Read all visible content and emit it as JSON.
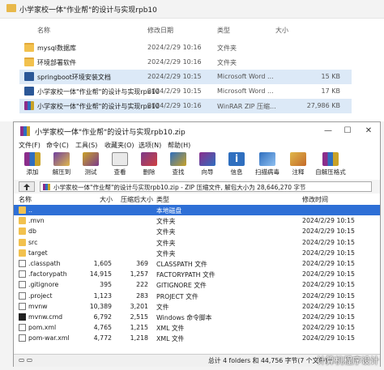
{
  "explorer": {
    "title": "小学家校一体\"作业帮\"的设计与实现rpb10",
    "columns": {
      "name": "名称",
      "date": "修改日期",
      "type": "类型",
      "size": "大小"
    },
    "rows": [
      {
        "name": "mysql数据库",
        "date": "2024/2/29 10:16",
        "type": "文件夹",
        "size": "",
        "icon": "folder-icon"
      },
      {
        "name": "环境部署软件",
        "date": "2024/2/29 10:16",
        "type": "文件夹",
        "size": "",
        "icon": "folder-icon"
      },
      {
        "name": "springboot环境安装文档",
        "date": "2024/2/29 10:15",
        "type": "Microsoft Word ...",
        "size": "15 KB",
        "icon": "word-doc-icon"
      },
      {
        "name": "小学家校一体\"作业帮\"的设计与实现rpb10",
        "date": "2024/2/29 10:15",
        "type": "Microsoft Word ...",
        "size": "17 KB",
        "icon": "word-doc-icon"
      },
      {
        "name": "小学家校一体\"作业帮\"的设计与实现rpb10",
        "date": "2024/2/29 10:16",
        "type": "WinRAR ZIP 压缩...",
        "size": "27,986 KB",
        "icon": "zip-archive-icon"
      }
    ]
  },
  "winrar": {
    "title": "小学家校一体\"作业帮\"的设计与实现rpb10.zip",
    "menu": [
      "文件(F)",
      "命令(C)",
      "工具(S)",
      "收藏夹(O)",
      "选项(N)",
      "帮助(H)"
    ],
    "toolbar": [
      "添加",
      "解压到",
      "测试",
      "查看",
      "删除",
      "查找",
      "向导",
      "信息",
      "扫描病毒",
      "注释",
      "自解压格式"
    ],
    "address": "小学家校一体\"作业帮\"的设计与实现rpb10.zip - ZIP 压缩文件, 解包大小为 28,646,270 字节",
    "columns": {
      "name": "名称",
      "size": "大小",
      "packed": "压缩后大小",
      "type": "类型",
      "modified": "修改时间"
    },
    "files": [
      {
        "name": "..",
        "size": "",
        "packed": "",
        "type": "本地磁盘",
        "modified": "",
        "icon": "folder-icon"
      },
      {
        "name": ".mvn",
        "size": "",
        "packed": "",
        "type": "文件夹",
        "modified": "2024/2/29 10:15",
        "icon": "folder-icon"
      },
      {
        "name": "db",
        "size": "",
        "packed": "",
        "type": "文件夹",
        "modified": "2024/2/29 10:15",
        "icon": "folder-icon"
      },
      {
        "name": "src",
        "size": "",
        "packed": "",
        "type": "文件夹",
        "modified": "2024/2/29 10:15",
        "icon": "folder-icon"
      },
      {
        "name": "target",
        "size": "",
        "packed": "",
        "type": "文件夹",
        "modified": "2024/2/29 10:15",
        "icon": "folder-icon"
      },
      {
        "name": ".classpath",
        "size": "1,605",
        "packed": "369",
        "type": "CLASSPATH 文件",
        "modified": "2024/2/29 10:15",
        "icon": "file-icon"
      },
      {
        "name": ".factorypath",
        "size": "14,915",
        "packed": "1,257",
        "type": "FACTORYPATH 文件",
        "modified": "2024/2/29 10:15",
        "icon": "file-icon"
      },
      {
        "name": ".gitignore",
        "size": "395",
        "packed": "222",
        "type": "GITIGNORE 文件",
        "modified": "2024/2/29 10:15",
        "icon": "file-icon"
      },
      {
        "name": ".project",
        "size": "1,123",
        "packed": "283",
        "type": "PROJECT 文件",
        "modified": "2024/2/29 10:15",
        "icon": "file-icon"
      },
      {
        "name": "mvnw",
        "size": "10,389",
        "packed": "3,201",
        "type": "文件",
        "modified": "2024/2/29 10:15",
        "icon": "file-icon"
      },
      {
        "name": "mvnw.cmd",
        "size": "6,792",
        "packed": "2,515",
        "type": "Windows 命令脚本",
        "modified": "2024/2/29 10:15",
        "icon": "cmd-script-icon"
      },
      {
        "name": "pom.xml",
        "size": "4,765",
        "packed": "1,215",
        "type": "XML 文件",
        "modified": "2024/2/29 10:15",
        "icon": "file-icon"
      },
      {
        "name": "pom-war.xml",
        "size": "4,772",
        "packed": "1,218",
        "type": "XML 文件",
        "modified": "2024/2/29 10:15",
        "icon": "file-icon"
      }
    ],
    "status_left": "",
    "status_right": "总计 4 folders 和 44,756 字节(7 个文件)",
    "watermark": "计算机程序设计"
  },
  "colors": {
    "selection": "#2e6fd6",
    "folder": "#f2c14e",
    "word": "#2b5797"
  }
}
